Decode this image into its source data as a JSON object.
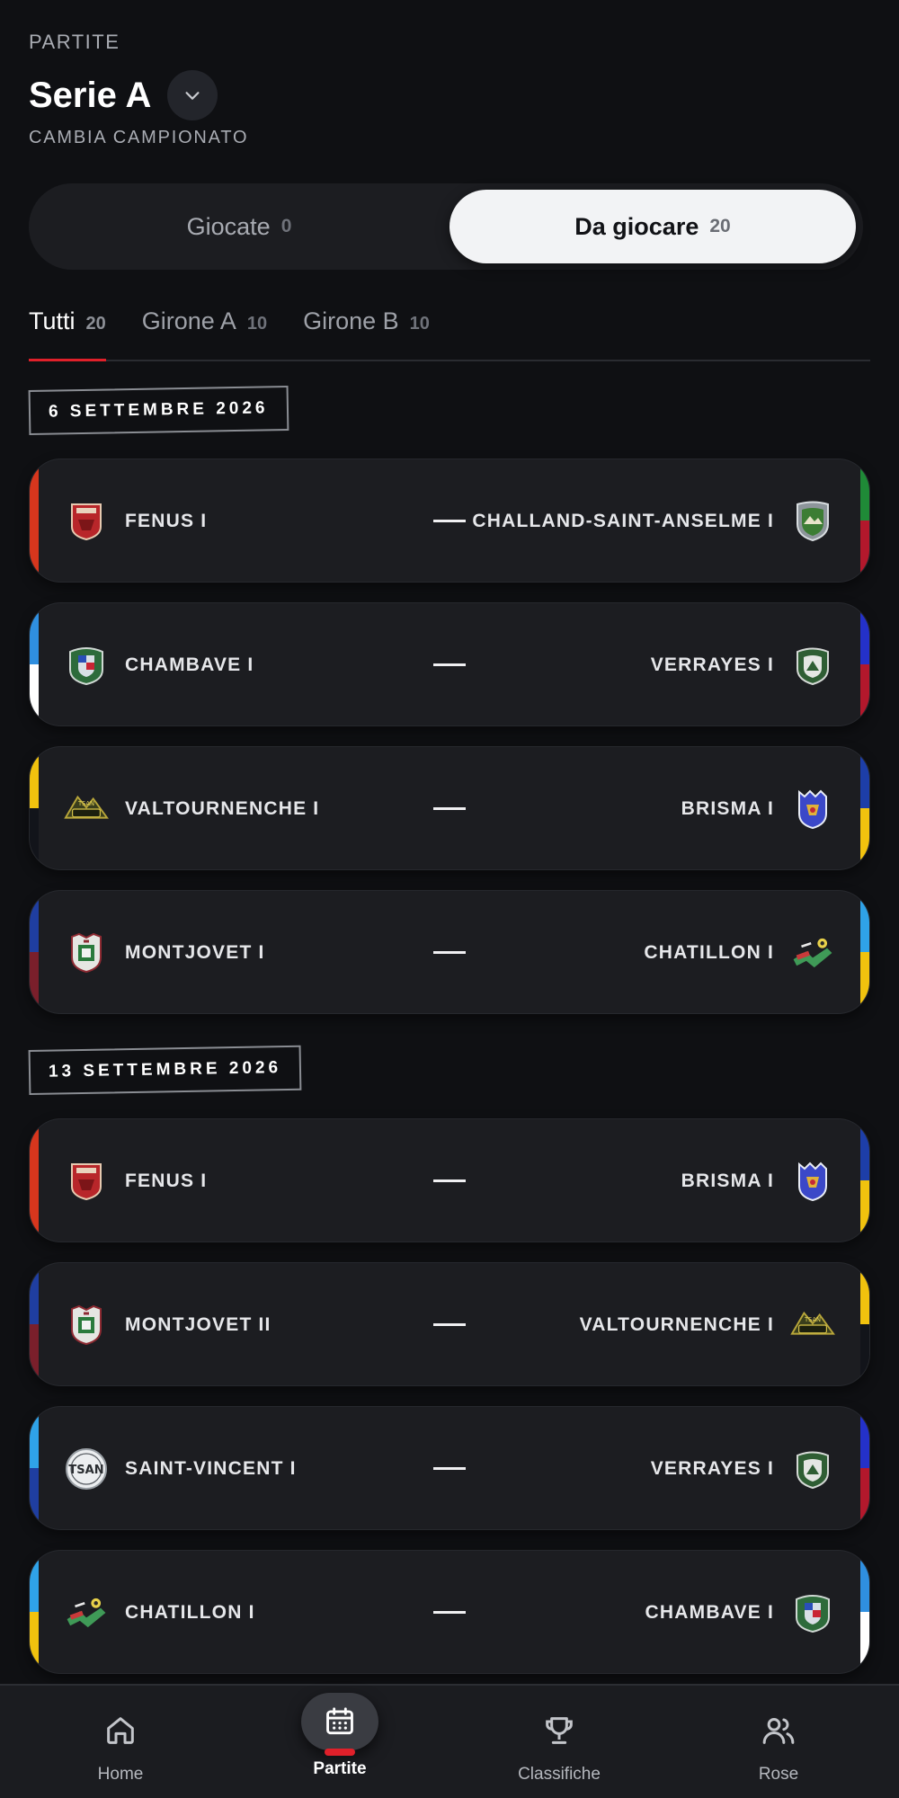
{
  "header": {
    "kicker": "PARTITE",
    "title": "Serie A",
    "change_label": "CAMBIA CAMPIONATO"
  },
  "toggle": {
    "left": {
      "label": "Giocate",
      "count": "0"
    },
    "right": {
      "label": "Da giocare",
      "count": "20"
    },
    "selected": "right"
  },
  "tabs": [
    {
      "label": "Tutti",
      "count": "20",
      "active": true
    },
    {
      "label": "Girone A",
      "count": "10",
      "active": false
    },
    {
      "label": "Girone B",
      "count": "10",
      "active": false
    }
  ],
  "dates": [
    "6 SETTEMBRE 2026",
    "13 SETTEMBRE 2026"
  ],
  "matches": [
    {
      "home": "FENUS I",
      "away": "CHALLAND-SAINT-ANSELME I",
      "home_logo": "fenus-crest",
      "away_logo": "challand-crest",
      "home_colors": [
        "#d7361d"
      ],
      "away_colors": [
        "#1f8a37",
        "#b3182c"
      ]
    },
    {
      "home": "CHAMBAVE I",
      "away": "VERRAYES I",
      "home_logo": "chambave-crest",
      "away_logo": "verrayes-crest",
      "home_colors": [
        "#2f8fe0",
        "#ffffff"
      ],
      "away_colors": [
        "#2431c9",
        "#b3182c"
      ]
    },
    {
      "home": "VALTOURNENCHE I",
      "away": "BRISMA I",
      "home_logo": "valtournenche-crest",
      "away_logo": "brisma-crest",
      "home_colors": [
        "#f1c20e",
        "#12141a"
      ],
      "away_colors": [
        "#1d3ea8",
        "#f1c20e"
      ]
    },
    {
      "home": "MONTJOVET I",
      "away": "CHATILLON I",
      "home_logo": "montjovet-crest",
      "away_logo": "chatillon-crest",
      "home_colors": [
        "#1f3ea0",
        "#7a1f2b"
      ],
      "away_colors": [
        "#2fa2e8",
        "#f1c20e"
      ]
    },
    {
      "home": "FENUS I",
      "away": "BRISMA I",
      "home_logo": "fenus-crest",
      "away_logo": "brisma-crest",
      "home_colors": [
        "#d7361d"
      ],
      "away_colors": [
        "#1d3ea8",
        "#f1c20e"
      ]
    },
    {
      "home": "MONTJOVET II",
      "away": "VALTOURNENCHE I",
      "home_logo": "montjovet-crest",
      "away_logo": "valtournenche-crest",
      "home_colors": [
        "#1f3ea0",
        "#7a1f2b"
      ],
      "away_colors": [
        "#f1c20e",
        "#12141a"
      ]
    },
    {
      "home": "SAINT-VINCENT I",
      "away": "VERRAYES I",
      "home_logo": "saint-vincent-crest",
      "away_logo": "verrayes-crest",
      "home_colors": [
        "#2fa2e8",
        "#1f3ea0"
      ],
      "away_colors": [
        "#2431c9",
        "#b3182c"
      ]
    },
    {
      "home": "CHATILLON I",
      "away": "CHAMBAVE I",
      "home_logo": "chatillon-crest",
      "away_logo": "chambave-crest",
      "home_colors": [
        "#2fa2e8",
        "#f1c20e"
      ],
      "away_colors": [
        "#2f8fe0",
        "#ffffff"
      ]
    }
  ],
  "nav": [
    {
      "label": "Home",
      "icon": "home-icon",
      "active": false
    },
    {
      "label": "Partite",
      "icon": "calendar-icon",
      "active": true
    },
    {
      "label": "Classifiche",
      "icon": "trophy-icon",
      "active": false
    },
    {
      "label": "Rose",
      "icon": "users-icon",
      "active": false
    }
  ],
  "accent_color": "#e0202a"
}
